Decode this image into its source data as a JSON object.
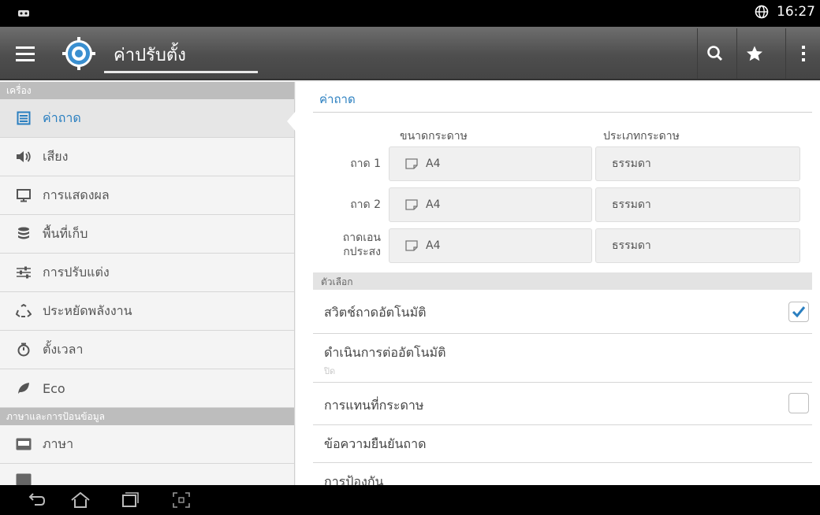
{
  "status_bar": {
    "left_icon": "notification-icon",
    "globe_icon": "globe-icon",
    "time": "16:27"
  },
  "app_bar": {
    "menu_icon": "hamburger-menu-icon",
    "app_icon": "gear-settings-icon",
    "title": "ค่าปรับตั้ง",
    "actions": [
      "search-icon",
      "star-icon",
      "overflow-menu-icon"
    ]
  },
  "sidebar": {
    "sections": [
      {
        "header": "เครื่อง",
        "items": [
          {
            "label": "ค่าถาด",
            "icon": "tray-list-icon",
            "active": true
          },
          {
            "label": "เสียง",
            "icon": "speaker-icon"
          },
          {
            "label": "การแสดงผล",
            "icon": "monitor-icon"
          },
          {
            "label": "พื้นที่เก็บ",
            "icon": "database-icon"
          },
          {
            "label": "การปรับแต่ง",
            "icon": "sliders-icon"
          },
          {
            "label": "ประหยัดพลังงาน",
            "icon": "recycle-icon"
          },
          {
            "label": "ตั้งเวลา",
            "icon": "timer-icon"
          },
          {
            "label": "Eco",
            "icon": "leaf-icon"
          }
        ]
      },
      {
        "header": "ภาษาและการป้อนข้อมูล",
        "items": [
          {
            "label": "ภาษา",
            "icon": "abc-keyboard-icon"
          }
        ]
      }
    ]
  },
  "content": {
    "title": "ค่าถาด",
    "columns": {
      "size": "ขนาดกระดาษ",
      "type": "ประเภทกระดาษ"
    },
    "trays": [
      {
        "label": "ถาด 1",
        "size": "A4",
        "type": "ธรรมดา"
      },
      {
        "label": "ถาด 2",
        "size": "A4",
        "type": "ธรรมดา"
      },
      {
        "label": "ถาดเอนกประสง",
        "label_line1": "ถาดเอน",
        "label_line2": "กประสง",
        "size": "A4",
        "type": "ธรรมดา"
      }
    ],
    "options_header": "ตัวเลือก",
    "options": [
      {
        "label": "สวิตช์ถาดอัตโนมัติ",
        "checkbox": true,
        "checked": true
      },
      {
        "label": "ดำเนินการต่ออัตโนมัติ",
        "sub": "ปิด"
      },
      {
        "label": "การแทนที่กระดาษ",
        "checkbox": true,
        "checked": false
      },
      {
        "label": "ข้อความยืนยันถาด"
      },
      {
        "label": "การป้องกัน"
      }
    ]
  },
  "nav_bar": {
    "icons": [
      "back-icon",
      "home-icon",
      "recent-apps-icon",
      "screenshot-icon"
    ]
  },
  "colors": {
    "accent": "#2a7fc0",
    "checkbox_tick": "#2a7fc0"
  }
}
